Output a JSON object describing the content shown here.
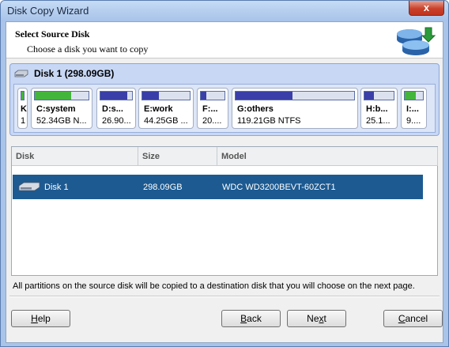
{
  "window": {
    "title": "Disk Copy Wizard",
    "close_label": "x"
  },
  "header": {
    "title": "Select Source Disk",
    "subtitle": "Choose a disk you want to copy"
  },
  "disk_map": {
    "disk_label": "Disk 1 (298.09GB)",
    "partitions": [
      {
        "name": "K",
        "info": "1",
        "used_fraction": 0.9,
        "color": "#43b53c"
      },
      {
        "name": "C:system",
        "info": "52.34GB N...",
        "used_fraction": 0.68,
        "color": "#43b53c"
      },
      {
        "name": "D:s...",
        "info": "26.90...",
        "used_fraction": 0.85,
        "color": "#3a3ea8"
      },
      {
        "name": "E:work",
        "info": "44.25GB ...",
        "used_fraction": 0.35,
        "color": "#3a3ea8"
      },
      {
        "name": "F:...",
        "info": "20....",
        "used_fraction": 0.22,
        "color": "#3a3ea8"
      },
      {
        "name": "G:others",
        "info": "119.21GB NTFS",
        "used_fraction": 0.48,
        "color": "#3a3ea8"
      },
      {
        "name": "H:b...",
        "info": "25.1...",
        "used_fraction": 0.32,
        "color": "#3a3ea8"
      },
      {
        "name": "I:...",
        "info": "9....",
        "used_fraction": 0.6,
        "color": "#43b53c"
      }
    ]
  },
  "table": {
    "columns": [
      "Disk",
      "Size",
      "Model"
    ],
    "rows": [
      {
        "disk": "Disk 1",
        "size": "298.09GB",
        "model": "WDC WD3200BEVT-60ZCT1"
      }
    ]
  },
  "info_text": "All partitions on the source disk will be copied to a destination disk that you will choose on the next page.",
  "buttons": {
    "help": {
      "accel": "H",
      "rest": "elp"
    },
    "back": {
      "accel": "B",
      "rest": "ack"
    },
    "next": {
      "pre": "Ne",
      "accel": "x",
      "rest": "t"
    },
    "cancel": {
      "accel": "C",
      "rest": "ancel"
    }
  },
  "colors": {
    "selection": "#1c5a91",
    "used_blue": "#3a3ea8",
    "used_green": "#43b53c"
  }
}
